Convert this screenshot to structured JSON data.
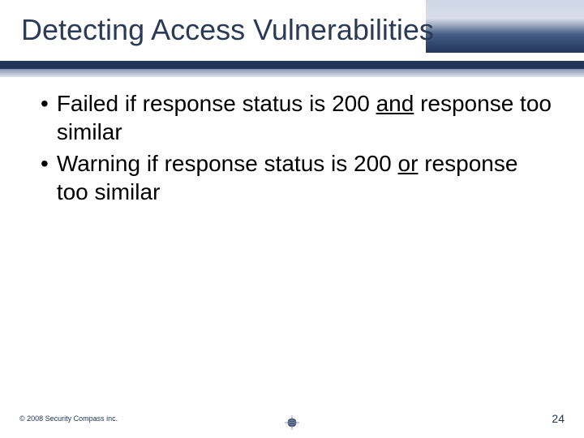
{
  "title": "Detecting Access Vulnerabilities",
  "bullets": [
    {
      "pre": "Failed if response status is 200 ",
      "u": "and",
      "post": " response too similar"
    },
    {
      "pre": "Warning if response status is 200 ",
      "u": "or",
      "post": " response too similar"
    }
  ],
  "footer": {
    "copyright": "© 2008 Security Compass inc.",
    "page_number": "24"
  },
  "colors": {
    "accent": "#233559"
  }
}
